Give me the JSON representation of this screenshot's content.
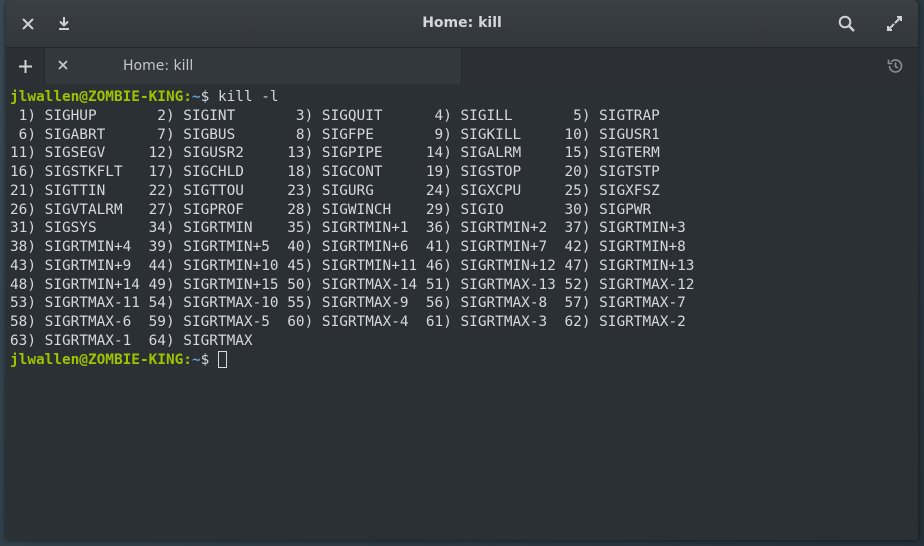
{
  "window": {
    "title": "Home: kill"
  },
  "tabs": [
    {
      "label": "Home: kill"
    }
  ],
  "terminal": {
    "prompt_user": "jlwallen@ZOMBIE-KING",
    "prompt_sep": ":",
    "prompt_path": "~",
    "prompt_symbol": "$ ",
    "command": "kill -l",
    "output": [
      " 1) SIGHUP       2) SIGINT       3) SIGQUIT      4) SIGILL       5) SIGTRAP",
      " 6) SIGABRT      7) SIGBUS       8) SIGFPE       9) SIGKILL     10) SIGUSR1",
      "11) SIGSEGV     12) SIGUSR2     13) SIGPIPE     14) SIGALRM     15) SIGTERM",
      "16) SIGSTKFLT   17) SIGCHLD     18) SIGCONT     19) SIGSTOP     20) SIGTSTP",
      "21) SIGTTIN     22) SIGTTOU     23) SIGURG      24) SIGXCPU     25) SIGXFSZ",
      "26) SIGVTALRM   27) SIGPROF     28) SIGWINCH    29) SIGIO       30) SIGPWR",
      "31) SIGSYS      34) SIGRTMIN    35) SIGRTMIN+1  36) SIGRTMIN+2  37) SIGRTMIN+3",
      "38) SIGRTMIN+4  39) SIGRTMIN+5  40) SIGRTMIN+6  41) SIGRTMIN+7  42) SIGRTMIN+8",
      "43) SIGRTMIN+9  44) SIGRTMIN+10 45) SIGRTMIN+11 46) SIGRTMIN+12 47) SIGRTMIN+13",
      "48) SIGRTMIN+14 49) SIGRTMIN+15 50) SIGRTMAX-14 51) SIGRTMAX-13 52) SIGRTMAX-12",
      "53) SIGRTMAX-11 54) SIGRTMAX-10 55) SIGRTMAX-9  56) SIGRTMAX-8  57) SIGRTMAX-7",
      "58) SIGRTMAX-6  59) SIGRTMAX-5  60) SIGRTMAX-4  61) SIGRTMAX-3  62) SIGRTMAX-2",
      "63) SIGRTMAX-1  64) SIGRTMAX"
    ]
  },
  "icons": {
    "close": "close-icon",
    "download": "download-icon",
    "search": "search-icon",
    "maximize": "maximize-icon",
    "new_tab": "plus-icon",
    "tab_close": "close-icon",
    "history": "history-icon"
  },
  "colors": {
    "prompt_user": "#9ec400",
    "prompt_path": "#5c9fd9",
    "background": "#2b3034",
    "text": "#d6d8da"
  }
}
